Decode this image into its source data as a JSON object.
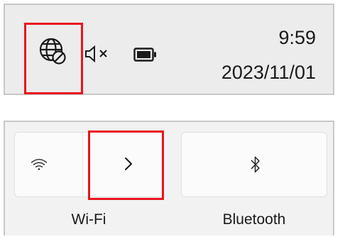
{
  "taskbar": {
    "icons": {
      "network": "globe-disconnected-icon",
      "volume": "speaker-muted-icon",
      "battery": "battery-icon"
    },
    "clock": {
      "time": "9:59",
      "date": "2023/11/01"
    }
  },
  "quick_settings": {
    "wifi": {
      "label": "Wi-Fi",
      "icon": "wifi-icon",
      "expand_icon": "chevron-right-icon"
    },
    "bluetooth": {
      "label": "Bluetooth",
      "icon": "bluetooth-icon"
    }
  },
  "colors": {
    "highlight": "#e8151c",
    "tray_background": "#ececec",
    "tile_background": "#fbfbfb"
  }
}
